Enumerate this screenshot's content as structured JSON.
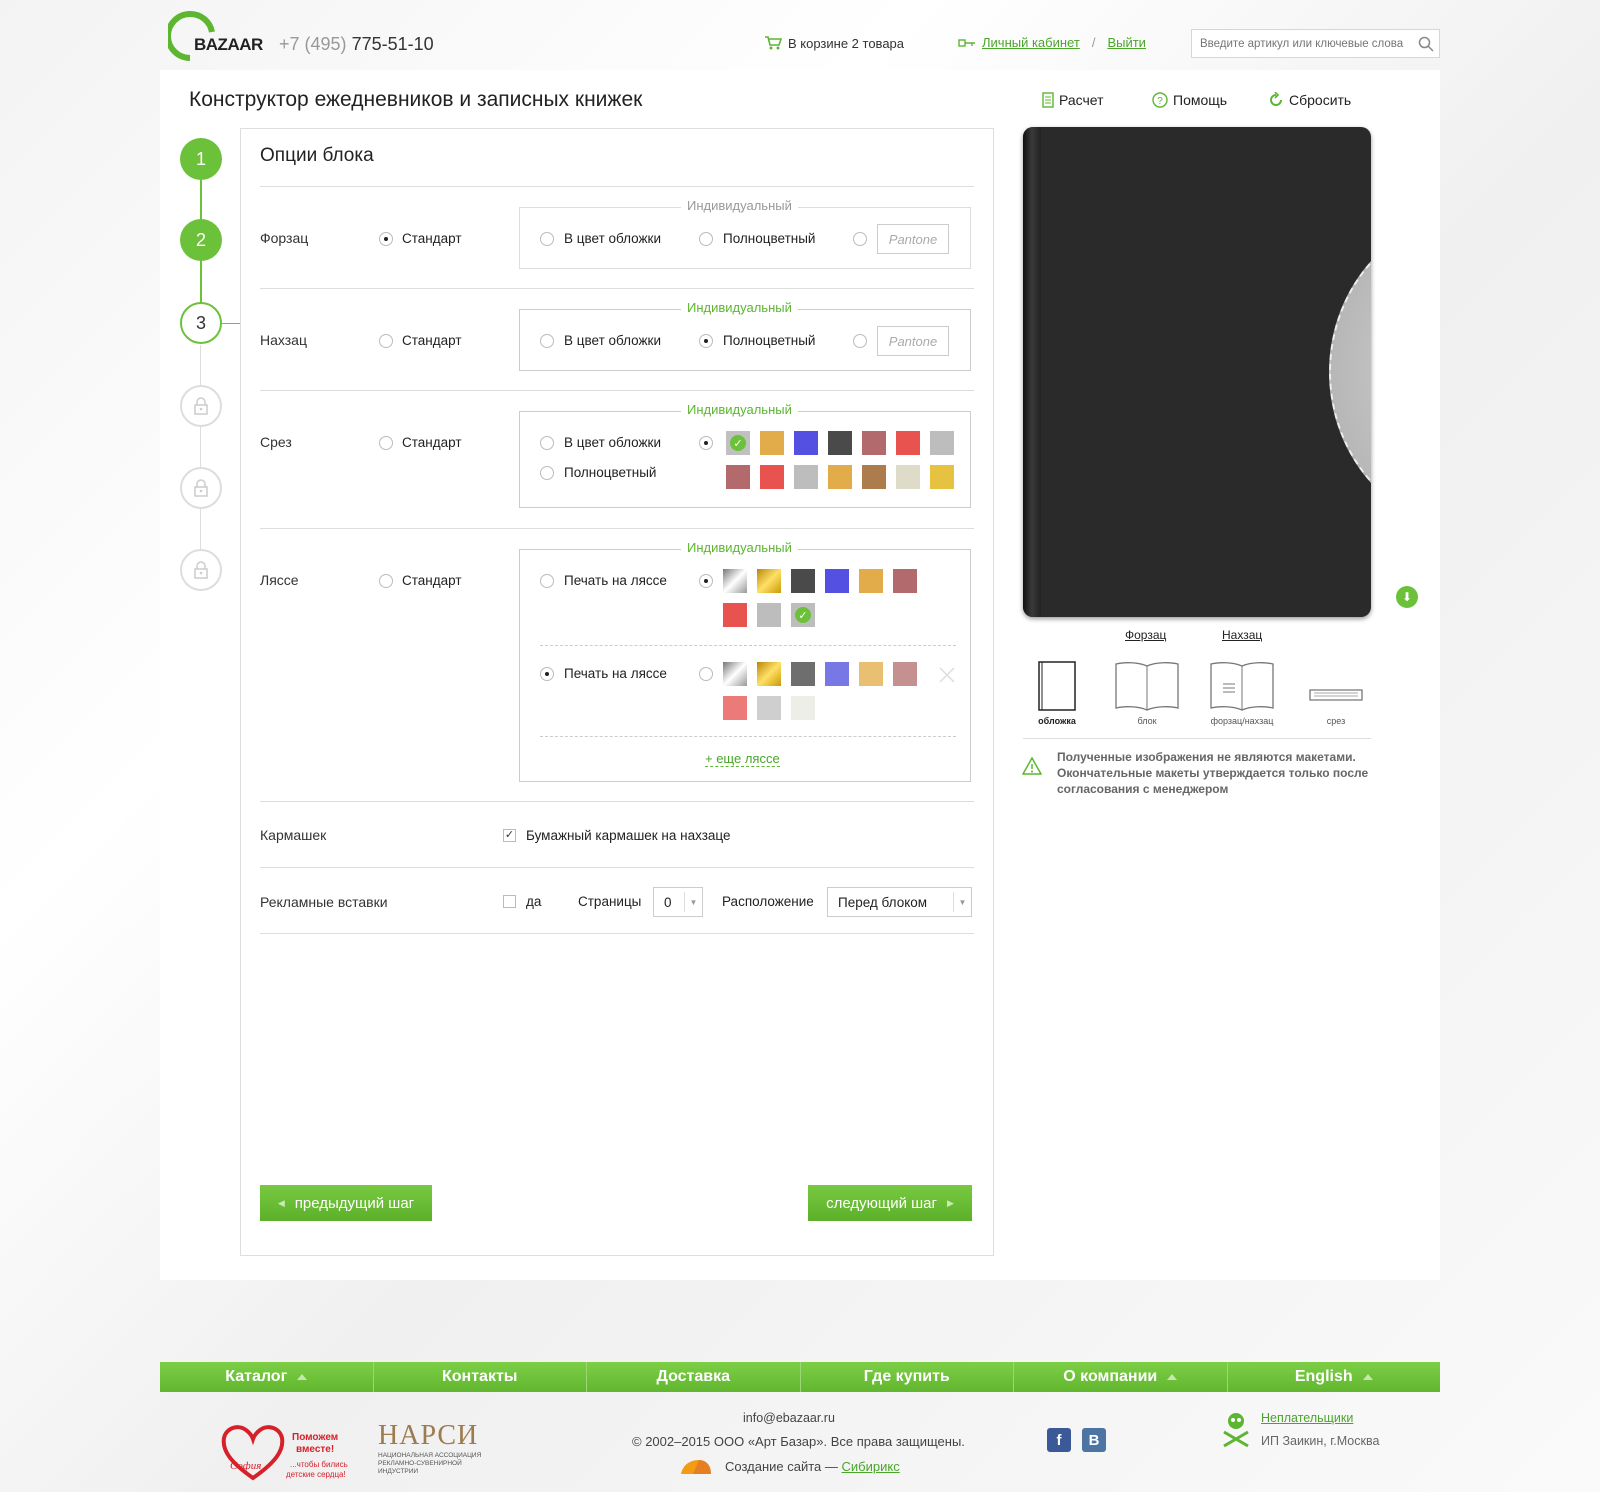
{
  "header": {
    "logo_text": "BAZAAR",
    "phone_code": "+7 (495)",
    "phone_number": "775-51-10",
    "cart_text": "В корзине 2 товара",
    "account_link": "Личный кабинет",
    "separator": "/",
    "logout_link": "Выйти",
    "search_placeholder": "Введите артикул или ключевые слова"
  },
  "page": {
    "title": "Конструктор ежедневников и записных книжек",
    "tools": {
      "calc": "Расчет",
      "help": "Помощь",
      "reset": "Сбросить"
    }
  },
  "steps": [
    {
      "label": "1",
      "state": "done"
    },
    {
      "label": "2",
      "state": "done"
    },
    {
      "label": "3",
      "state": "current"
    },
    {
      "label": "",
      "state": "locked"
    },
    {
      "label": "",
      "state": "locked"
    },
    {
      "label": "",
      "state": "locked"
    }
  ],
  "form": {
    "title": "Опции блока",
    "individual_legend": "Индивидуальный",
    "forzac": {
      "label": "Форзац",
      "standard": "Стандарт",
      "cover_color": "В цвет обложки",
      "full_color": "Полноцветный",
      "pantone_placeholder": "Pantone"
    },
    "nahzac": {
      "label": "Нахзац",
      "standard": "Стандарт",
      "cover_color": "В цвет обложки",
      "full_color": "Полноцветный",
      "pantone_placeholder": "Pantone"
    },
    "srez": {
      "label": "Срез",
      "standard": "Стандарт",
      "cover_color": "В цвет обложки",
      "full_color": "Полноцветный",
      "swatches_row1": [
        "#c0c0c0",
        "#e3ac4a",
        "#5450e2",
        "#4a4a4a",
        "#b26a6c",
        "#e8524f",
        "#bdbdbd"
      ],
      "swatches_row2": [
        "#b26a6c",
        "#e8524f",
        "#bdbdbd",
        "#e3ac4a",
        "#ac7c4c",
        "#dedbc9",
        "#e5c341"
      ]
    },
    "lyasse": {
      "label": "Ляссе",
      "standard": "Стандарт",
      "print1": "Печать на ляссе",
      "print2": "Печать на ляссе",
      "swatches1": [
        "silver",
        "gold",
        "#4a4a4a",
        "#5450e2",
        "#e3ac4a",
        "#b26a6c",
        "#e8524f",
        "#bdbdbd",
        "#bdbdbd"
      ],
      "swatches2": [
        "silver",
        "gold",
        "#6e6e6e",
        "#7777e6",
        "#e9bf72",
        "#c49090",
        "#ec7a78",
        "#cfcfcf",
        "#eeeee8"
      ],
      "more_link": "+ еще ляссе"
    },
    "pocket": {
      "label": "Кармашек",
      "option": "Бумажный кармашек на нахзаце"
    },
    "inserts": {
      "label": "Рекламные вставки",
      "yes": "да",
      "pages_label": "Страницы",
      "pages_value": "0",
      "position_label": "Расположение",
      "position_value": "Перед блоком"
    },
    "prev_button": "предыдущий шаг",
    "next_button": "следующий шаг"
  },
  "preview": {
    "link_forzac": "Форзац",
    "link_nahzac": "Нахзац",
    "thumbs": [
      "обложка",
      "блок",
      "форзац/нахзац",
      "срез"
    ],
    "warning": "Полученные изображения не являются макетами. Окончательные макеты утверждается только после согласования с менеджером"
  },
  "footer": {
    "nav": [
      "Каталог",
      "Контакты",
      "Доставка",
      "Где купить",
      "О компании",
      "English"
    ],
    "email": "info@ebazaar.ru",
    "copyright": "© 2002–2015 ООО «Арт Базар». Все права защищены.",
    "dev_text": "Создание сайта —",
    "dev_link": "Сибирикс",
    "charity_line1": "Поможем",
    "charity_line2": "вместе!",
    "charity_sub1": "...чтобы бились",
    "charity_sub2": "детские сердца!",
    "charity_logo": "София",
    "narsi": "НАРСИ",
    "narsi_sub1": "НАЦИОНАЛЬНАЯ АССОЦИАЦИЯ",
    "narsi_sub2": "РЕКЛАМНО-СУВЕНИРНОЙ",
    "narsi_sub3": "ИНДУСТРИИ",
    "social_fb": "f",
    "social_vk": "B",
    "nonpayers_link": "Неплательщики",
    "nonpayers_name": "ИП Заикин, г.Москва"
  }
}
